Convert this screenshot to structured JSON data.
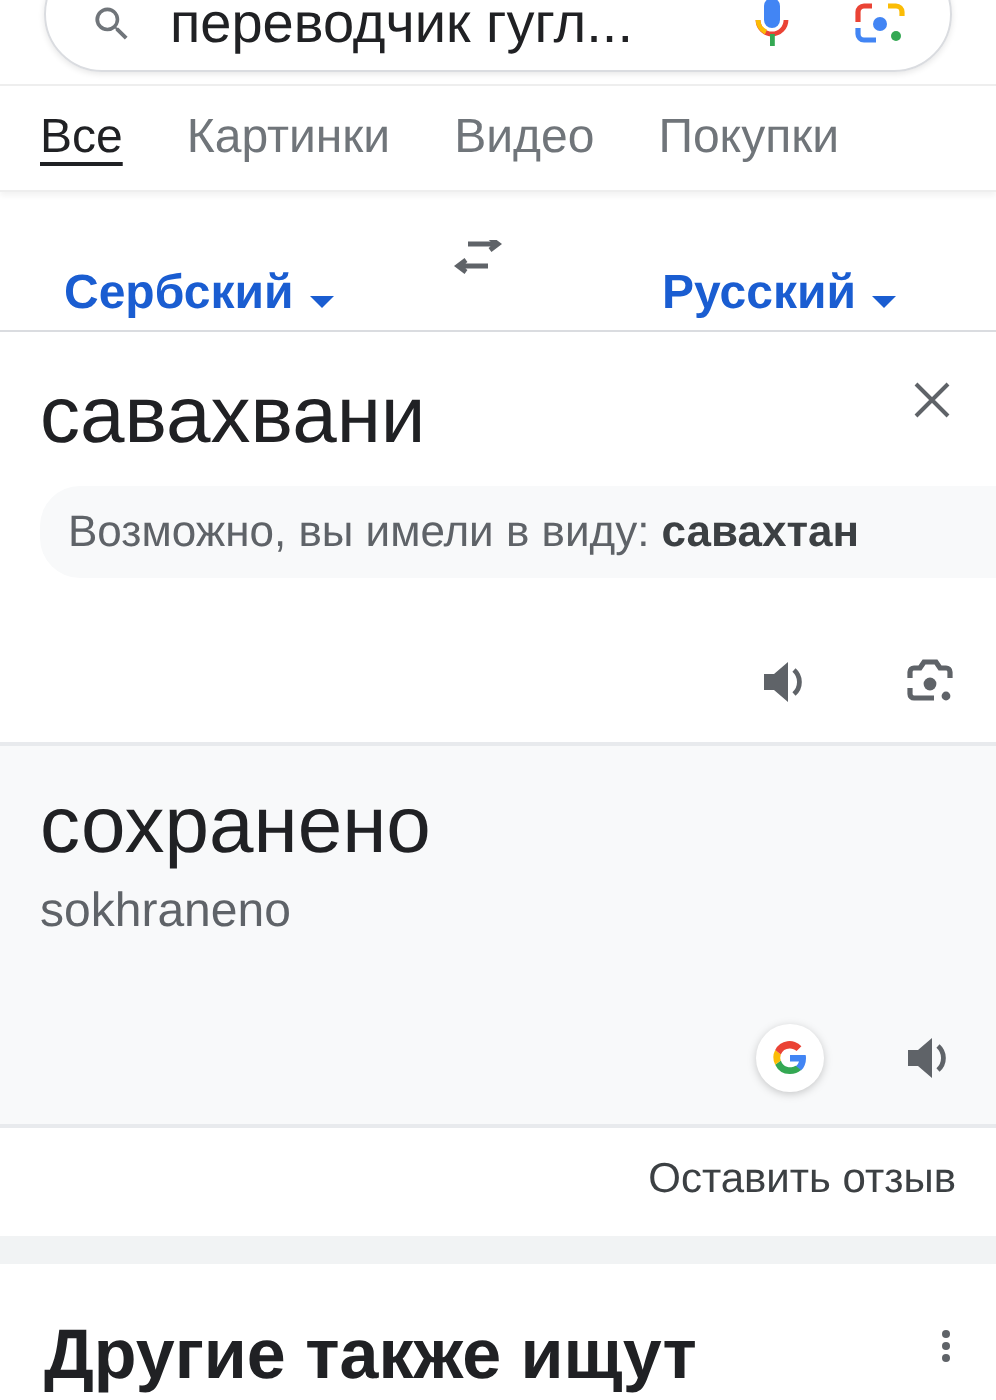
{
  "search": {
    "value": "переводчик гугл..."
  },
  "tabs": [
    {
      "label": "Все",
      "selected": true
    },
    {
      "label": "Картинки",
      "selected": false
    },
    {
      "label": "Видео",
      "selected": false
    },
    {
      "label": "Покупки",
      "selected": false
    }
  ],
  "translator": {
    "source_language": "Сербский",
    "target_language": "Русский",
    "input": "савахвани",
    "suggestion": "Возможно, вы имели в виду: **савахтан**",
    "output": "сохранено",
    "transliteration": "sokhraneno",
    "feedback": "Оставить отзыв"
  },
  "related": {
    "title": "Другие также ищут"
  }
}
